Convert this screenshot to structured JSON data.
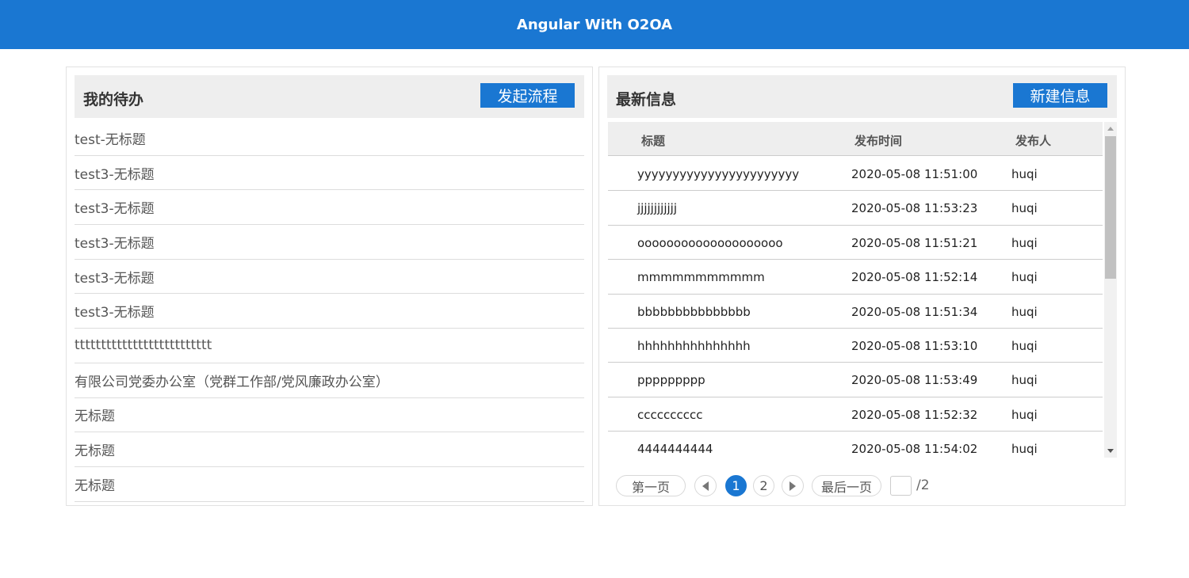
{
  "app": {
    "title": "Angular With O2OA"
  },
  "todo": {
    "title": "我的待办",
    "button_label": "发起流程",
    "items": [
      "test-无标题",
      "test3-无标题",
      "test3-无标题",
      "test3-无标题",
      "test3-无标题",
      "test3-无标题",
      "tttttttttttttttttttttttttt",
      "有限公司党委办公室（党群工作部/党风廉政办公室）",
      "无标题",
      "无标题",
      "无标题"
    ]
  },
  "news": {
    "title": "最新信息",
    "button_label": "新建信息",
    "columns": [
      "标题",
      "发布时间",
      "发布人"
    ],
    "rows": [
      {
        "title": "yyyyyyyyyyyyyyyyyyyyyyy",
        "time": "2020-05-08 11:51:00",
        "author": "huqi"
      },
      {
        "title": "jjjjjjjjjjjj",
        "time": "2020-05-08 11:53:23",
        "author": "huqi"
      },
      {
        "title": "oooooooooooooooooooo",
        "time": "2020-05-08 11:51:21",
        "author": "huqi"
      },
      {
        "title": "mmmmmmmmmmm",
        "time": "2020-05-08 11:52:14",
        "author": "huqi"
      },
      {
        "title": "bbbbbbbbbbbbbbb",
        "time": "2020-05-08 11:51:34",
        "author": "huqi"
      },
      {
        "title": "hhhhhhhhhhhhhhh",
        "time": "2020-05-08 11:53:10",
        "author": "huqi"
      },
      {
        "title": "ppppppppp",
        "time": "2020-05-08 11:53:49",
        "author": "huqi"
      },
      {
        "title": "cccccccccc",
        "time": "2020-05-08 11:52:32",
        "author": "huqi"
      },
      {
        "title": "4444444444",
        "time": "2020-05-08 11:54:02",
        "author": "huqi"
      }
    ],
    "pager": {
      "first_label": "第一页",
      "last_label": "最后一页",
      "pages": [
        "1",
        "2"
      ],
      "current_page": "1",
      "total_label": "/2"
    }
  },
  "colors": {
    "brand": "#1a77d2",
    "header_bg": "#eeeeee"
  }
}
